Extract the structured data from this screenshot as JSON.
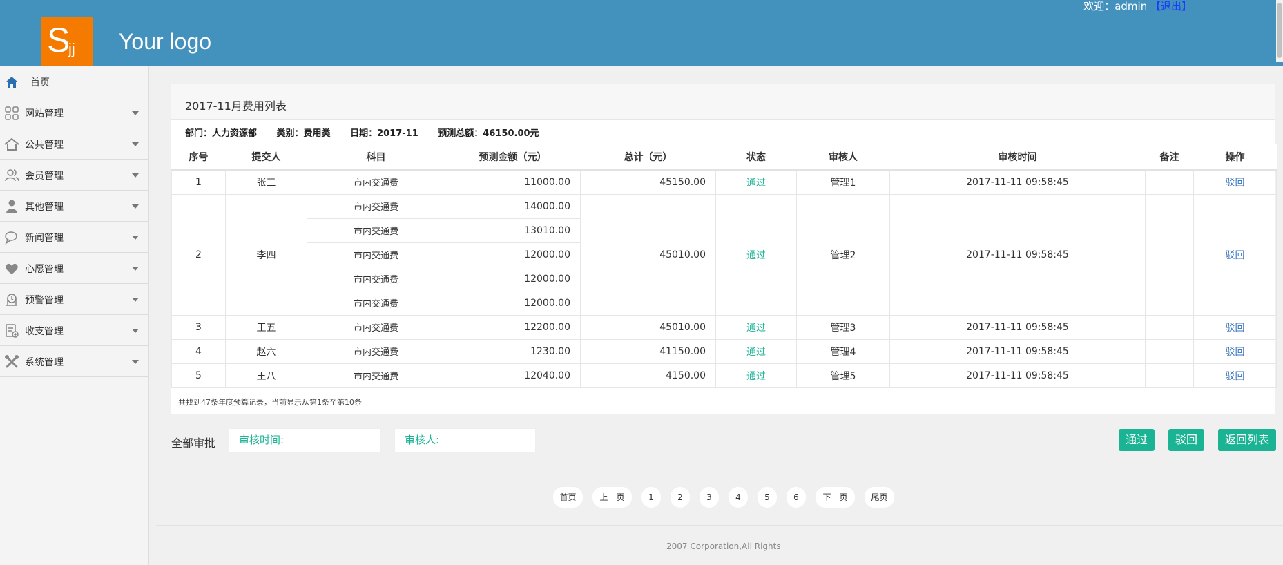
{
  "header": {
    "logo_big": "S",
    "logo_small": "jj",
    "logo_text": "Your logo",
    "welcome": "欢迎：admin",
    "logout": "【退出】"
  },
  "sidebar": {
    "items": [
      {
        "label": "首页",
        "icon": "home-icon"
      },
      {
        "label": "网站管理",
        "icon": "grid-icon"
      },
      {
        "label": "公共管理",
        "icon": "house-icon"
      },
      {
        "label": "会员管理",
        "icon": "users-icon"
      },
      {
        "label": "其他管理",
        "icon": "person-icon"
      },
      {
        "label": "新闻管理",
        "icon": "chat-icon"
      },
      {
        "label": "心愿管理",
        "icon": "heart-icon"
      },
      {
        "label": "预警管理",
        "icon": "alarm-icon"
      },
      {
        "label": "收支管理",
        "icon": "finance-icon"
      },
      {
        "label": "系统管理",
        "icon": "tools-icon"
      }
    ]
  },
  "panel": {
    "title": "2017-11月费用列表",
    "meta": {
      "dept": "部门：人力资源部",
      "category": "类别：费用类",
      "date": "日期：2017-11",
      "total": "预测总额：46150.00元"
    },
    "columns": [
      "序号",
      "提交人",
      "科目",
      "预测金额（元）",
      "总计（元）",
      "状态",
      "审核人",
      "审核时间",
      "备注",
      "操作"
    ],
    "rows": [
      {
        "no": "1",
        "submitter": "张三",
        "items": [
          {
            "subject": "市内交通费",
            "amount": "11000.00"
          }
        ],
        "total": "45150.00",
        "status": "通过",
        "reviewer": "管理1",
        "time": "2017-11-11 09:58:45",
        "remark": "",
        "action": "驳回"
      },
      {
        "no": "2",
        "submitter": "李四",
        "items": [
          {
            "subject": "市内交通费",
            "amount": "14000.00"
          },
          {
            "subject": "市内交通费",
            "amount": "13010.00"
          },
          {
            "subject": "市内交通费",
            "amount": "12000.00"
          },
          {
            "subject": "市内交通费",
            "amount": "12000.00"
          },
          {
            "subject": "市内交通费",
            "amount": "12000.00"
          }
        ],
        "total": "45010.00",
        "status": "通过",
        "reviewer": "管理2",
        "time": "2017-11-11 09:58:45",
        "remark": "",
        "action": "驳回"
      },
      {
        "no": "3",
        "submitter": "王五",
        "items": [
          {
            "subject": "市内交通费",
            "amount": "12200.00"
          }
        ],
        "total": "45010.00",
        "status": "通过",
        "reviewer": "管理3",
        "time": "2017-11-11 09:58:45",
        "remark": "",
        "action": "驳回"
      },
      {
        "no": "4",
        "submitter": "赵六",
        "items": [
          {
            "subject": "市内交通费",
            "amount": "1230.00"
          }
        ],
        "total": "41150.00",
        "status": "通过",
        "reviewer": "管理4",
        "time": "2017-11-11 09:58:45",
        "remark": "",
        "action": "驳回"
      },
      {
        "no": "5",
        "submitter": "王八",
        "items": [
          {
            "subject": "市内交通费",
            "amount": "12040.00"
          }
        ],
        "total": "4150.00",
        "status": "通过",
        "reviewer": "管理5",
        "time": "2017-11-11 09:58:45",
        "remark": "",
        "action": "驳回"
      }
    ],
    "footnote": "共找到47条年度预算记录，当前显示从第1条至第10条"
  },
  "approval": {
    "label": "全部审批",
    "time_placeholder": "审核时间:",
    "reviewer_placeholder": "审核人:",
    "pass": "通过",
    "reject": "驳回",
    "back_list": "返回列表"
  },
  "pagination": {
    "first": "首页",
    "prev": "上一页",
    "pages": [
      "1",
      "2",
      "3",
      "4",
      "5",
      "6"
    ],
    "next": "下一页",
    "last": "尾页"
  },
  "footer": {
    "copyright": "2007 Corporation,All Rights"
  },
  "colors": {
    "header": "#4392bd",
    "logo": "#f47b00",
    "accent": "#1ab394",
    "link": "#3a75bd"
  }
}
